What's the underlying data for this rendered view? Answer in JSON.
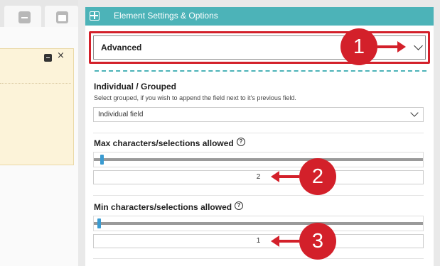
{
  "left_pane": {
    "tabs": [
      {
        "icon": "minus-square-icon"
      },
      {
        "icon": "window-square-icon"
      }
    ],
    "note_close": "×"
  },
  "panel": {
    "header_icon": "layout-grid-icon",
    "title": "Element Settings & Options",
    "settings_mode": {
      "value": "Advanced"
    },
    "individual_grouped": {
      "title": "Individual / Grouped",
      "description": "Select grouped, if you wish to append the field next to it's previous field.",
      "value": "Individual field"
    },
    "max_chars": {
      "title": "Max characters/selections allowed",
      "help": "?",
      "value": "2",
      "slider_fraction": 0.02
    },
    "min_chars": {
      "title": "Min characters/selections allowed",
      "help": "?",
      "value": "1",
      "slider_fraction": 0.01
    }
  },
  "callouts": [
    {
      "label": "1"
    },
    {
      "label": "2"
    },
    {
      "label": "3"
    }
  ],
  "colors": {
    "header": "#4cb3b8",
    "highlight": "#d3202a",
    "slider_handle": "#3a9bd1",
    "note_bg": "#fcf3d9"
  }
}
